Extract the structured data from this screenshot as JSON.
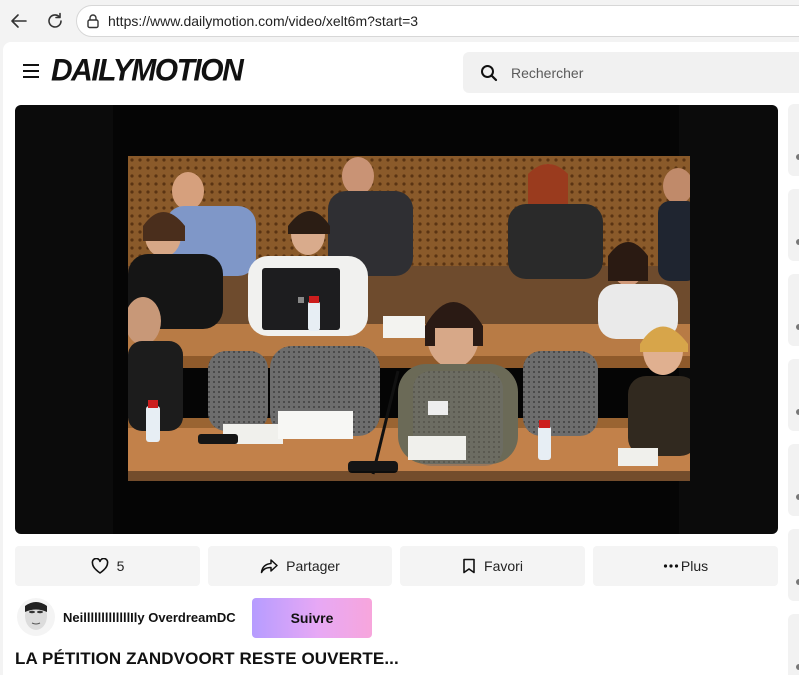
{
  "browser": {
    "url": "https://www.dailymotion.com/video/xelt6m?start=3"
  },
  "header": {
    "logo": "DAILYMOTION",
    "search_placeholder": "Rechercher"
  },
  "actions": {
    "like_count": "5",
    "share_label": "Partager",
    "favorite_label": "Favori",
    "more_label": "Plus"
  },
  "channel": {
    "name": "NeilllllllllllllIly OverdreamDC",
    "follow_label": "Suivre"
  },
  "video": {
    "title": "LA PÉTITION ZANDVOORT RESTE OUVERTE..."
  },
  "colors": {
    "follow_gradient_start": "#b69cff",
    "follow_gradient_end": "#f7a6dc",
    "action_bg": "#f4f4f4",
    "player_bg": "#0b0b0b"
  }
}
